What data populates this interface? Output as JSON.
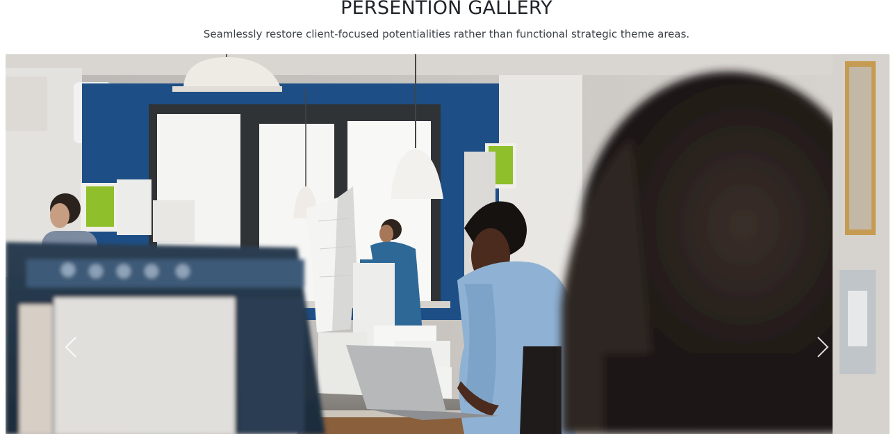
{
  "gallery": {
    "title": "PERSENTION GALLERY",
    "subtitle": "Seamlessly restore client-focused potentialities rather than functional strategic theme areas."
  },
  "carousel": {
    "slide_image_icon": "office-photo",
    "prev_icon": "chevron-left-icon",
    "next_icon": "chevron-right-icon"
  },
  "colors": {
    "title_text": "#1f2328",
    "subtitle_text": "#3a3f45",
    "control_chevron": "#ffffff",
    "office_wall_blue": "#1d4f86"
  }
}
